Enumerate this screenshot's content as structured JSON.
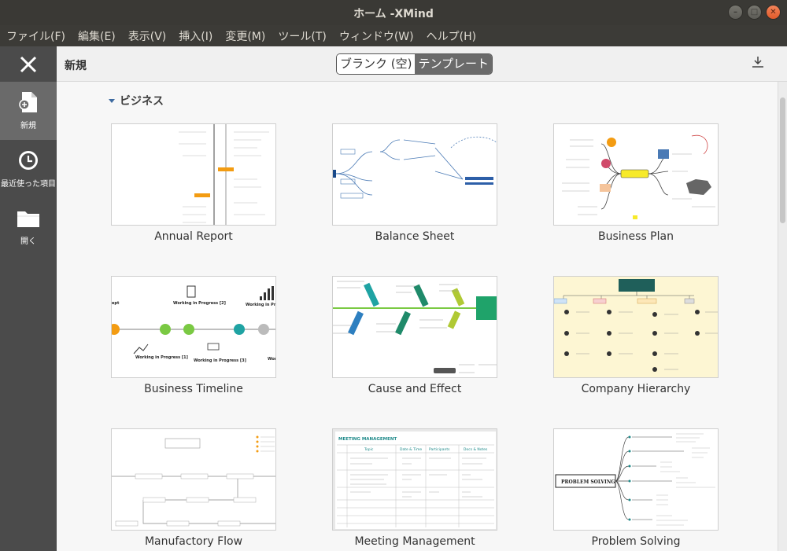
{
  "window": {
    "title": "ホーム -XMind"
  },
  "menu": [
    "ファイル(F)",
    "編集(E)",
    "表示(V)",
    "挿入(I)",
    "変更(M)",
    "ツール(T)",
    "ウィンドウ(W)",
    "ヘルプ(H)"
  ],
  "sidebar": {
    "items": [
      {
        "label": "新規",
        "icon": "new-file-icon"
      },
      {
        "label": "最近使った項目",
        "icon": "clock-icon"
      },
      {
        "label": "開く",
        "icon": "folder-icon"
      }
    ]
  },
  "toolbar": {
    "title": "新規",
    "segment": {
      "blank": "ブランク (空)",
      "template": "テンプレート"
    }
  },
  "section": {
    "title": "ビジネス"
  },
  "templates": [
    {
      "name": "Annual Report"
    },
    {
      "name": "Balance Sheet"
    },
    {
      "name": "Business Plan"
    },
    {
      "name": "Business Timeline"
    },
    {
      "name": "Cause and Effect"
    },
    {
      "name": "Company Hierarchy"
    },
    {
      "name": "Manufactory Flow"
    },
    {
      "name": "Meeting Management"
    },
    {
      "name": "Problem Solving"
    }
  ],
  "colors": {
    "accent": "#3d6aa0",
    "sidebar": "#4b4b4b",
    "sidebar_active": "#6a6a6a"
  }
}
